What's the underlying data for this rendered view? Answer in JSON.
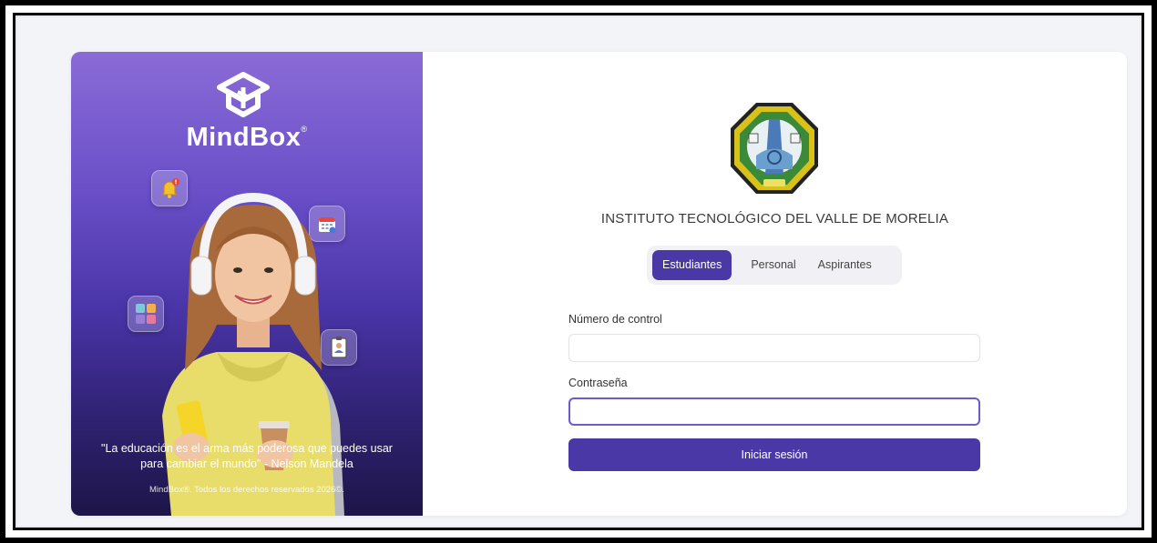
{
  "brand": {
    "name": "MindBox",
    "trademark": "®"
  },
  "left_panel": {
    "quote": "\"La educación es el arma más poderosa que puedes usar para cambiar el mundo\" - Nelson Mandela",
    "copyright": "MindBox®. Todos los derechos reservados 2026©.",
    "floating_icons": [
      "bell-alert-icon",
      "calendar-icon",
      "image-gallery-icon",
      "id-badge-icon"
    ]
  },
  "institution": {
    "name": "INSTITUTO TECNOLÓGICO DEL VALLE DE MORELIA"
  },
  "tabs": [
    {
      "label": "Estudiantes",
      "active": true
    },
    {
      "label": "Personal",
      "active": false
    },
    {
      "label": "Aspirantes",
      "active": false
    }
  ],
  "form": {
    "control_label": "Número de control",
    "control_value": "",
    "password_label": "Contraseña",
    "password_value": "",
    "submit_label": "Iniciar sesión"
  },
  "colors": {
    "accent": "#4a38a6",
    "panel_top": "#8a6bd6",
    "panel_bottom": "#1d1548",
    "focus_border": "#6a5bd0"
  }
}
